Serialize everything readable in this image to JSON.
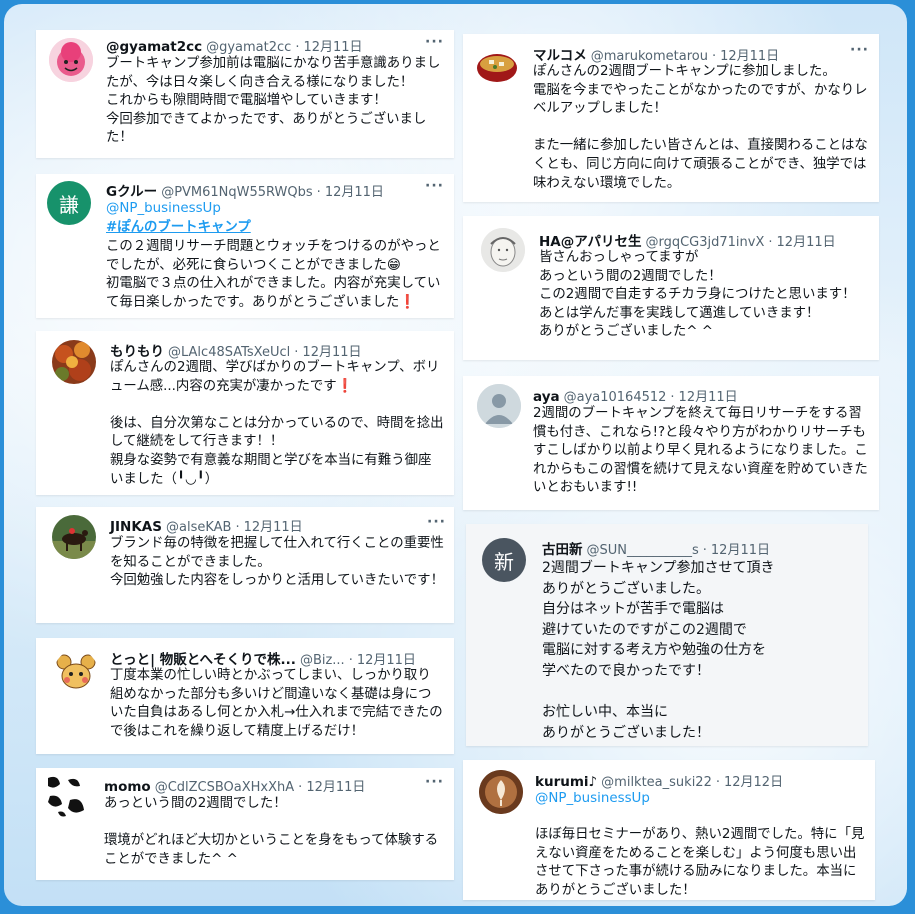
{
  "tweets": [
    {
      "name": "@gyamat2cc",
      "handle": "@gyamat2cc",
      "date": "12月11日",
      "avatar": "pink-face-avatar",
      "text": "ブートキャンプ参加前は電脳にかなり苦手意識ありましたが、今は日々楽しく向き合える様になりました！\nこれからも隙間時間で電脳増やしていきます！\n今回参加できてよかったです、ありがとうございました！"
    },
    {
      "name": "Gクルー",
      "handle": "@PVM61NqW55RWQbs",
      "date": "12月11日",
      "avatar_text": "謙",
      "avatar_color": "#17926b",
      "reply_to": "@NP_businessUp",
      "hashtag": "#ぽんのブートキャンプ",
      "text": "この２週間リサーチ問題とウォッチをつけるのがやっとでしたが、必死に食らいつくことができました😁\n初電脳で３点の仕入れができました。内容が充実していて毎日楽しかったです。ありがとうございました❗"
    },
    {
      "name": "もりもり",
      "handle": "@LAlc48SATsXeUcl",
      "date": "12月11日",
      "avatar": "autumn-leaves-avatar",
      "text": "ぽんさんの2週間、学びばかりのブートキャンプ、ボリューム感...内容の充実が凄かったです❗\n\n後は、自分次第なことは分かっているので、時間を捻出して継続をして行きます！！\n親身な姿勢で有意義な期間と学びを本当に有難う御座いました（╹◡╹）"
    },
    {
      "name": "JINKAS",
      "handle": "@alseKAB",
      "date": "12月11日",
      "avatar": "horse-avatar",
      "text": "ブランド毎の特徴を把握して仕入れて行くことの重要性を知ることができました。\n今回勉強した内容をしっかりと活用していきたいです！"
    },
    {
      "name": "とっと| 物販とへそくりで株...",
      "handle": "@Biz...",
      "date": "12月11日",
      "avatar": "mouse-character-avatar",
      "text": "丁度本業の忙しい時とかぶってしまい、しっかり取り組めなかった部分も多いけど間違いなく基礎は身についた自負はあるし何とか入札→仕入れまで完結できたので後はこれを繰り返して精度上げるだけ！"
    },
    {
      "name": "momo",
      "handle": "@CdlZCSBOaXHxXhA",
      "date": "12月11日",
      "avatar": "cow-pattern-avatar",
      "text": "あっという間の2週間でした！\n\n環境がどれほど大切かということを身をもって体験することができました^ ^"
    },
    {
      "name": "マルコメ",
      "handle": "@marukometarou",
      "date": "12月11日",
      "avatar": "miso-soup-avatar",
      "text": "ぽんさんの2週間ブートキャンプに参加しました。\n電脳を今までやったことがなかったのですが、かなりレベルアップしました！\n\nまた一緒に参加したい皆さんとは、直接関わることはなくとも、同じ方向に向けて頑張ることができ、独学では味わえない環境でした。"
    },
    {
      "name": "HA@アパリセ生",
      "handle": "@rgqCG3jd71invX",
      "date": "12月11日",
      "avatar": "sketch-face-avatar",
      "text": "皆さんおっしゃってますが\nあっという間の2週間でした！\nこの2週間で自走するチカラ身につけたと思います！\nあとは学んだ事を実践して邁進していきます！\nありがとうございました^ ^"
    },
    {
      "name": "aya",
      "handle": "@aya10164512",
      "date": "12月11日",
      "avatar": "default-user-avatar",
      "text": "2週間のブートキャンプを終えて毎日リサーチをする習慣も付き、これなら!?と段々やり方がわかりリサーチもすこしばかり以前より早く見れるようになりました。これからもこの習慣を続けて見えない資産を貯めていきたいとおもいます!!"
    },
    {
      "name": "古田新",
      "handle": "@SUN__________s",
      "date": "12月11日",
      "avatar_text": "新",
      "avatar_color": "#4a5560",
      "text": "2週間ブートキャンプ参加させて頂き\nありがとうございました。\n自分はネットが苦手で電脳は\n避けていたのですがこの2週間で\n電脳に対する考え方や勉強の仕方を\n学べたので良かったです！\n\nお忙しい中、本当に\nありがとうございました！"
    },
    {
      "name": "kurumi♪",
      "handle": "@milktea_suki22",
      "date": "12月12日",
      "avatar": "latte-art-avatar",
      "reply_to": "@NP_businessUp",
      "text": "ほぼ毎日セミナーがあり、熱い2週間でした。特に「見えない資産をためることを楽しむ」よう何度も思い出させて下さった事が続ける励みになりました。本当にありがとうございました！"
    }
  ],
  "more_label": "···",
  "separator": "·"
}
